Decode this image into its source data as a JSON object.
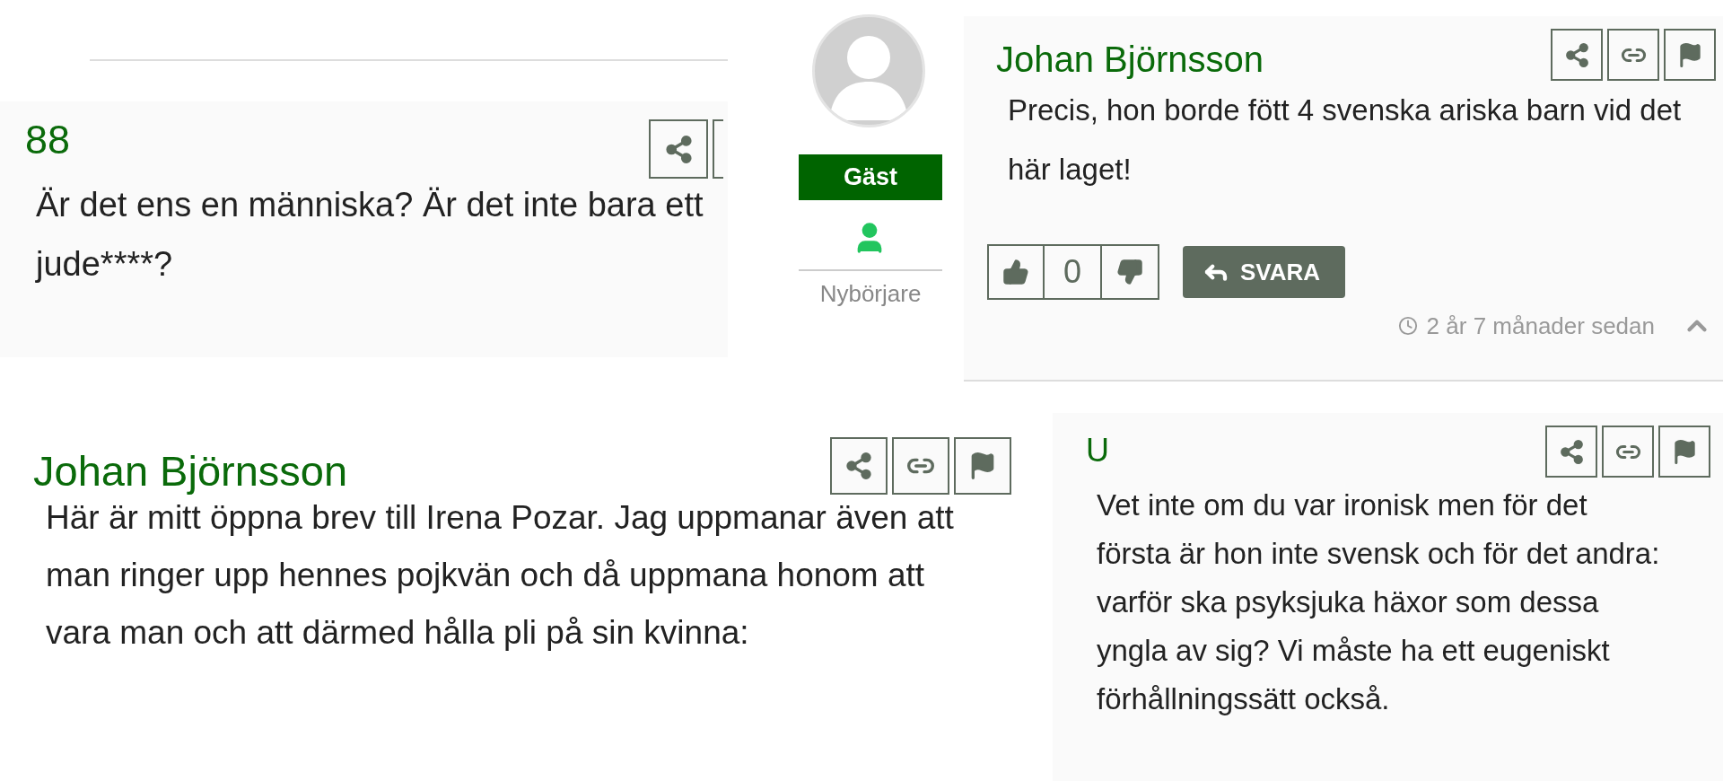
{
  "top_left_comment": {
    "author": "88",
    "actions": [
      {
        "kind": "share"
      },
      {
        "kind": "link",
        "cut_off": true
      }
    ],
    "body": "Är det ens en människa? Är det inte bara ett jude****?"
  },
  "profile": {
    "badge": "Gäst",
    "rank": "Nybörjare"
  },
  "top_right_comment": {
    "author": "Johan Björnsson",
    "actions": [
      {
        "kind": "share"
      },
      {
        "kind": "link"
      },
      {
        "kind": "flag"
      }
    ],
    "body": "Precis, hon borde fött 4 svenska ariska barn vid det här laget!",
    "vote_count": "0",
    "reply_button": "SVARA",
    "time": "2 år 7 månader sedan"
  },
  "bottom_left_comment": {
    "author": "Johan Björnsson",
    "actions": [
      {
        "kind": "share"
      },
      {
        "kind": "link"
      },
      {
        "kind": "flag"
      }
    ],
    "body": "Här är mitt öppna brev till Irena Pozar. Jag uppmanar även att man ringer upp hennes pojkvän och då uppmana honom att vara man och att därmed hålla pli på sin kvinna:"
  },
  "bottom_right_comment": {
    "author": "U",
    "actions": [
      {
        "kind": "share"
      },
      {
        "kind": "link"
      },
      {
        "kind": "flag"
      }
    ],
    "body": "Vet inte om du var ironisk men för det första är hon inte svensk och för det andra: varför ska psyksjuka häxor som dessa yngla av sig? Vi måste ha ett eugeniskt förhållningssätt också."
  }
}
